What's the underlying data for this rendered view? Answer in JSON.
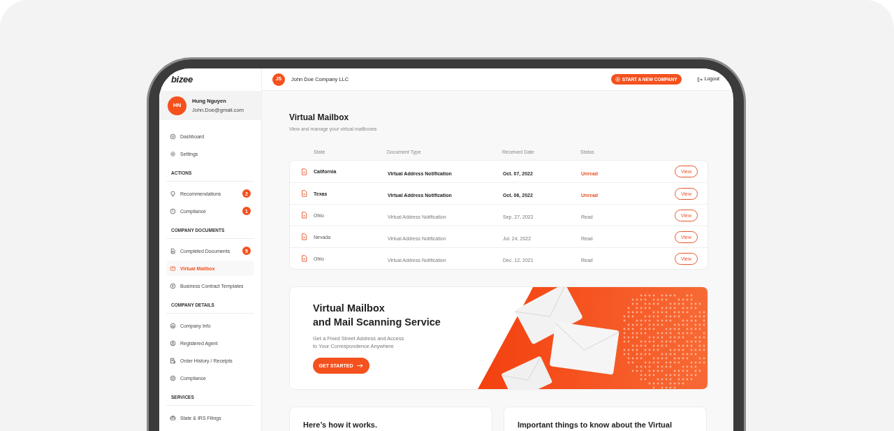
{
  "brand": {
    "logo": "bizee"
  },
  "user": {
    "initials": "HN",
    "name": "Hung Nguyen",
    "email": "John.Doe@gmail.com"
  },
  "sidebar": {
    "sections": [
      {
        "items": [
          {
            "label": "Dashboard",
            "selected": false
          },
          {
            "label": "Settings",
            "selected": false
          }
        ]
      },
      {
        "heading": "ACTIONS",
        "items": [
          {
            "label": "Recommendations",
            "badge": "2",
            "selected": false
          },
          {
            "label": "Compliance",
            "badge": "1",
            "selected": false
          }
        ]
      },
      {
        "heading": "COMPANY DOCUMENTS",
        "items": [
          {
            "label": "Completed Documents",
            "badge": "5",
            "selected": false
          },
          {
            "label": "Virtual Mailbox",
            "selected": true
          },
          {
            "label": "Business Contract Templates",
            "selected": false
          }
        ]
      },
      {
        "heading": "COMPANY DETAILS",
        "items": [
          {
            "label": "Company Info",
            "selected": false
          },
          {
            "label": "Registered Agent",
            "selected": false
          },
          {
            "label": "Order History / Receipts",
            "selected": false
          },
          {
            "label": "Compliance",
            "selected": false
          }
        ]
      },
      {
        "heading": "SERVICES",
        "items": [
          {
            "label": "State & IRS Filings",
            "selected": false
          }
        ]
      }
    ]
  },
  "header": {
    "company_initials": "JS",
    "company": "John Doe Company LLC",
    "start_button": "START A NEW COMPANY",
    "logout": "Logout"
  },
  "page": {
    "title": "Virtual Mailbox",
    "subtitle": "View and manage your virtual mailboxes"
  },
  "table": {
    "columns": [
      "State",
      "Document Type",
      "Received Date",
      "Status"
    ],
    "rows": [
      {
        "state": "California",
        "document_type": "Virtual Address Notification",
        "received_date": "Oct. 07, 2022",
        "status": "Unread",
        "unread": true,
        "action": "View"
      },
      {
        "state": "Texas",
        "document_type": "Virtual Address Notification",
        "received_date": "Oct. 06, 2022",
        "status": "Unread",
        "unread": true,
        "action": "View"
      },
      {
        "state": "Ohio",
        "document_type": "Virtual Address Notification",
        "received_date": "Sep. 27, 2022",
        "status": "Read",
        "unread": false,
        "action": "View"
      },
      {
        "state": "Nevada",
        "document_type": "Virtual Address Notification",
        "received_date": "Jul. 24, 2022",
        "status": "Read",
        "unread": false,
        "action": "View"
      },
      {
        "state": "Ohio",
        "document_type": "Virtual Address Notification",
        "received_date": "Dec. 12, 2021",
        "status": "Read",
        "unread": false,
        "action": "View"
      }
    ]
  },
  "banner": {
    "title_lines": [
      "Virtual Mailbox",
      "and Mail Scanning Service"
    ],
    "subtitle_lines": [
      "Get a Fixed Street Address and Access",
      "to Your Correspondence Anywhere"
    ],
    "button": "GET STARTED"
  },
  "cards": [
    {
      "title": "Here’s how it works."
    },
    {
      "title": "Important things to know about the Virtual"
    }
  ]
}
